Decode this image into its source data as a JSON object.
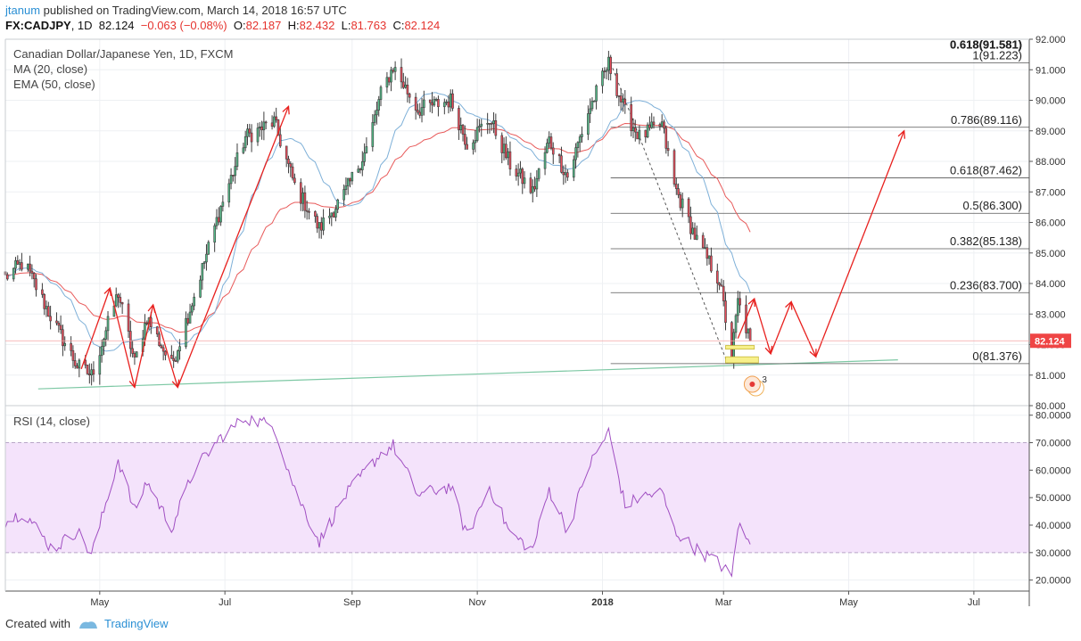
{
  "header": {
    "user": "jtanum",
    "published": "published on TradingView.com, March 14, 2018 16:57 UTC",
    "symbol": "FX:CADJPY",
    "interval": ", 1D",
    "last": "82.124",
    "change": "−0.063 (−0.08%)",
    "o_label": "O:",
    "o_val": "82.187",
    "h_label": "H:",
    "h_val": "82.432",
    "l_label": "L:",
    "l_val": "81.763",
    "c_label": "C:",
    "c_val": "82.124"
  },
  "footer": {
    "created_with": "Created with",
    "brand": "TradingView"
  },
  "colors": {
    "up": "#53b987",
    "down": "#eb4d5c",
    "ma": "#7eb0d8",
    "ema": "#e85a5a",
    "rsi": "#a04fc2",
    "rsi_band": "#f4e3fb",
    "arrow": "#e8201e",
    "trend": "#7dc8a4",
    "fib": "#555555",
    "price_tag": "#ef4545"
  },
  "chart_data": [
    {
      "type": "candlestick",
      "title": "Canadian Dollar/Japanese Yen, 1D, FXCM",
      "indicators": [
        "MA (20, close)",
        "EMA (50, close)"
      ],
      "ylim": [
        80.0,
        92.0
      ],
      "y_ticks": [
        "92.000",
        "91.000",
        "90.000",
        "89.000",
        "88.000",
        "87.000",
        "86.000",
        "85.000",
        "84.000",
        "83.000",
        "82.000",
        "81.000",
        "80.000"
      ],
      "x_ticks": [
        "May",
        "Jul",
        "Sep",
        "Nov",
        "2018",
        "Mar",
        "May",
        "Jul"
      ],
      "x_tick_dates": [
        "2017-05-01",
        "2017-07-01",
        "2017-09-01",
        "2017-11-01",
        "2018-01-01",
        "2018-03-01",
        "2018-05-01",
        "2018-07-01"
      ],
      "x_range": [
        "2017-03-16",
        "2018-07-28"
      ],
      "current_price": "82.124",
      "anchors": [
        {
          "date": "2017-03-16",
          "close": 84.2
        },
        {
          "date": "2017-03-25",
          "close": 84.7
        },
        {
          "date": "2017-04-08",
          "close": 82.8
        },
        {
          "date": "2017-04-20",
          "close": 81.3
        },
        {
          "date": "2017-04-27",
          "close": 81.0
        },
        {
          "date": "2017-05-10",
          "close": 83.7
        },
        {
          "date": "2017-05-18",
          "close": 81.4
        },
        {
          "date": "2017-05-24",
          "close": 82.9
        },
        {
          "date": "2017-06-05",
          "close": 81.3
        },
        {
          "date": "2017-06-16",
          "close": 83.6
        },
        {
          "date": "2017-06-29",
          "close": 86.5
        },
        {
          "date": "2017-07-11",
          "close": 88.8
        },
        {
          "date": "2017-07-25",
          "close": 89.3
        },
        {
          "date": "2017-08-04",
          "close": 87.2
        },
        {
          "date": "2017-08-16",
          "close": 85.8
        },
        {
          "date": "2017-08-28",
          "close": 86.9
        },
        {
          "date": "2017-09-08",
          "close": 88.4
        },
        {
          "date": "2017-09-15",
          "close": 90.2
        },
        {
          "date": "2017-09-21",
          "close": 91.1
        },
        {
          "date": "2017-10-03",
          "close": 89.7
        },
        {
          "date": "2017-10-19",
          "close": 90.0
        },
        {
          "date": "2017-10-27",
          "close": 88.6
        },
        {
          "date": "2017-11-07",
          "close": 89.4
        },
        {
          "date": "2017-11-17",
          "close": 87.9
        },
        {
          "date": "2017-11-28",
          "close": 87.0
        },
        {
          "date": "2017-12-06",
          "close": 88.7
        },
        {
          "date": "2017-12-15",
          "close": 87.5
        },
        {
          "date": "2017-12-25",
          "close": 89.6
        },
        {
          "date": "2018-01-04",
          "close": 91.2
        },
        {
          "date": "2018-01-12",
          "close": 89.6
        },
        {
          "date": "2018-01-19",
          "close": 88.8
        },
        {
          "date": "2018-01-30",
          "close": 89.2
        },
        {
          "date": "2018-02-05",
          "close": 87.2
        },
        {
          "date": "2018-02-16",
          "close": 85.4
        },
        {
          "date": "2018-02-27",
          "close": 84.1
        },
        {
          "date": "2018-03-05",
          "close": 81.6
        },
        {
          "date": "2018-03-08",
          "close": 83.4
        },
        {
          "date": "2018-03-14",
          "close": 82.12
        }
      ],
      "fibonacci": [
        {
          "label": "0(81.376)",
          "price": 81.376
        },
        {
          "label": "0.236(83.700)",
          "price": 83.7
        },
        {
          "label": "0.382(85.138)",
          "price": 85.138
        },
        {
          "label": "0.5(86.300)",
          "price": 86.3
        },
        {
          "label": "0.618(87.462)",
          "price": 87.462
        },
        {
          "label": "0.786(89.116)",
          "price": 89.116
        },
        {
          "label": "1(91.223)",
          "price": 91.223
        },
        {
          "label": "0.618(91.581)",
          "price": 91.581
        },
        {
          "label": "0.618(91.581)",
          "price": 91.581
        }
      ],
      "fib_range": {
        "from_date": "2018-01-05",
        "to_date": "2018-07-28"
      },
      "trendline": [
        {
          "date": "2017-04-01",
          "price": 80.55
        },
        {
          "date": "2018-05-25",
          "price": 81.5
        }
      ],
      "retrace_line": [
        {
          "date": "2018-01-05",
          "price": 91.22
        },
        {
          "date": "2018-03-03",
          "price": 81.38
        }
      ],
      "arrows": [
        [
          {
            "date": "2017-04-22",
            "price": 81.2
          },
          {
            "date": "2017-05-06",
            "price": 83.85
          }
        ],
        [
          {
            "date": "2017-05-06",
            "price": 83.85
          },
          {
            "date": "2017-05-18",
            "price": 80.6
          }
        ],
        [
          {
            "date": "2017-05-18",
            "price": 80.6
          },
          {
            "date": "2017-05-27",
            "price": 83.3
          }
        ],
        [
          {
            "date": "2017-05-27",
            "price": 83.3
          },
          {
            "date": "2017-06-08",
            "price": 80.6
          }
        ],
        [
          {
            "date": "2017-06-08",
            "price": 80.6
          },
          {
            "date": "2017-08-01",
            "price": 89.8
          }
        ],
        [
          {
            "date": "2018-03-08",
            "price": 82.2
          },
          {
            "date": "2018-03-16",
            "price": 83.5
          }
        ],
        [
          {
            "date": "2018-03-16",
            "price": 83.5
          },
          {
            "date": "2018-03-24",
            "price": 81.7
          }
        ],
        [
          {
            "date": "2018-03-24",
            "price": 81.7
          },
          {
            "date": "2018-04-03",
            "price": 83.4
          }
        ],
        [
          {
            "date": "2018-04-03",
            "price": 83.4
          },
          {
            "date": "2018-04-15",
            "price": 81.6
          }
        ],
        [
          {
            "date": "2018-04-15",
            "price": 81.6
          },
          {
            "date": "2018-05-28",
            "price": 89.0
          }
        ]
      ],
      "highlight_boxes": [
        {
          "from_date": "2018-03-02",
          "to_date": "2018-03-16",
          "low": 81.85,
          "high": 81.97
        },
        {
          "from_date": "2018-03-02",
          "to_date": "2018-03-18",
          "low": 81.4,
          "high": 81.6
        }
      ],
      "event_badge": {
        "date": "2018-03-15",
        "price": 80.7,
        "count": "3"
      }
    },
    {
      "type": "line",
      "title": "RSI (14, close)",
      "ylim": [
        16.0,
        82.5
      ],
      "y_ticks": [
        "80.0000",
        "70.0000",
        "60.0000",
        "50.0000",
        "40.0000",
        "30.0000",
        "20.0000"
      ],
      "band": [
        30,
        70
      ],
      "anchors": [
        {
          "date": "2017-03-16",
          "value": 41
        },
        {
          "date": "2017-03-25",
          "value": 45
        },
        {
          "date": "2017-04-08",
          "value": 31
        },
        {
          "date": "2017-04-20",
          "value": 38
        },
        {
          "date": "2017-04-27",
          "value": 29
        },
        {
          "date": "2017-05-10",
          "value": 64
        },
        {
          "date": "2017-05-18",
          "value": 45
        },
        {
          "date": "2017-05-24",
          "value": 56
        },
        {
          "date": "2017-06-05",
          "value": 39
        },
        {
          "date": "2017-06-16",
          "value": 60
        },
        {
          "date": "2017-06-29",
          "value": 72
        },
        {
          "date": "2017-07-11",
          "value": 79
        },
        {
          "date": "2017-07-25",
          "value": 76
        },
        {
          "date": "2017-08-04",
          "value": 53
        },
        {
          "date": "2017-08-16",
          "value": 34
        },
        {
          "date": "2017-08-28",
          "value": 50
        },
        {
          "date": "2017-09-08",
          "value": 60
        },
        {
          "date": "2017-09-15",
          "value": 66
        },
        {
          "date": "2017-09-21",
          "value": 69
        },
        {
          "date": "2017-10-03",
          "value": 51
        },
        {
          "date": "2017-10-19",
          "value": 54
        },
        {
          "date": "2017-10-27",
          "value": 36
        },
        {
          "date": "2017-11-07",
          "value": 54
        },
        {
          "date": "2017-11-17",
          "value": 37
        },
        {
          "date": "2017-11-28",
          "value": 31
        },
        {
          "date": "2017-12-06",
          "value": 53
        },
        {
          "date": "2017-12-15",
          "value": 38
        },
        {
          "date": "2017-12-25",
          "value": 61
        },
        {
          "date": "2018-01-04",
          "value": 74
        },
        {
          "date": "2018-01-12",
          "value": 47
        },
        {
          "date": "2018-01-19",
          "value": 50
        },
        {
          "date": "2018-01-30",
          "value": 52
        },
        {
          "date": "2018-02-05",
          "value": 38
        },
        {
          "date": "2018-02-16",
          "value": 31
        },
        {
          "date": "2018-02-27",
          "value": 26
        },
        {
          "date": "2018-03-05",
          "value": 21
        },
        {
          "date": "2018-03-08",
          "value": 40
        },
        {
          "date": "2018-03-14",
          "value": 33
        }
      ]
    }
  ]
}
